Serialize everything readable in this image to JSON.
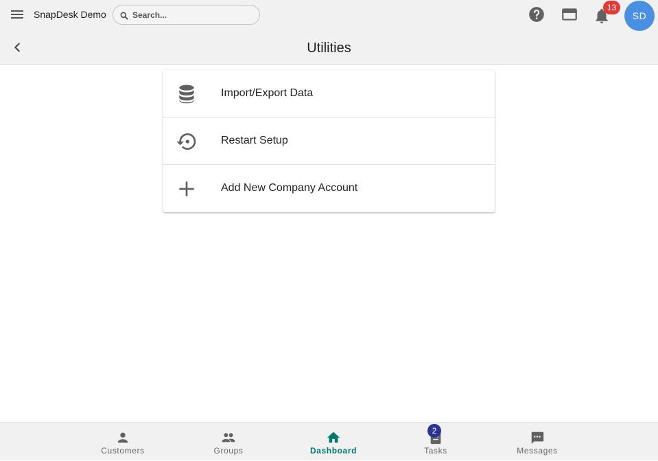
{
  "header": {
    "app_name": "SnapDesk Demo",
    "search_placeholder": "Search...",
    "notifications_count": "13",
    "avatar_initials": "SD",
    "page_title": "Utilities"
  },
  "utilities": [
    {
      "label": "Import/Export Data",
      "icon": "database-icon"
    },
    {
      "label": "Restart Setup",
      "icon": "restore-icon"
    },
    {
      "label": "Add New Company Account",
      "icon": "plus-icon"
    }
  ],
  "bottom_nav": [
    {
      "label": "Customers",
      "icon": "person-icon"
    },
    {
      "label": "Groups",
      "icon": "people-icon"
    },
    {
      "label": "Dashboard",
      "icon": "home-icon",
      "active": true
    },
    {
      "label": "Tasks",
      "icon": "clipboard-icon",
      "badge": "2"
    },
    {
      "label": "Messages",
      "icon": "message-icon"
    }
  ],
  "colors": {
    "accent_active": "#00796b",
    "notification_badge": "#e53935",
    "avatar_bg": "#4a90e2",
    "tasks_badge": "#283593",
    "icon_gray": "#616161"
  }
}
